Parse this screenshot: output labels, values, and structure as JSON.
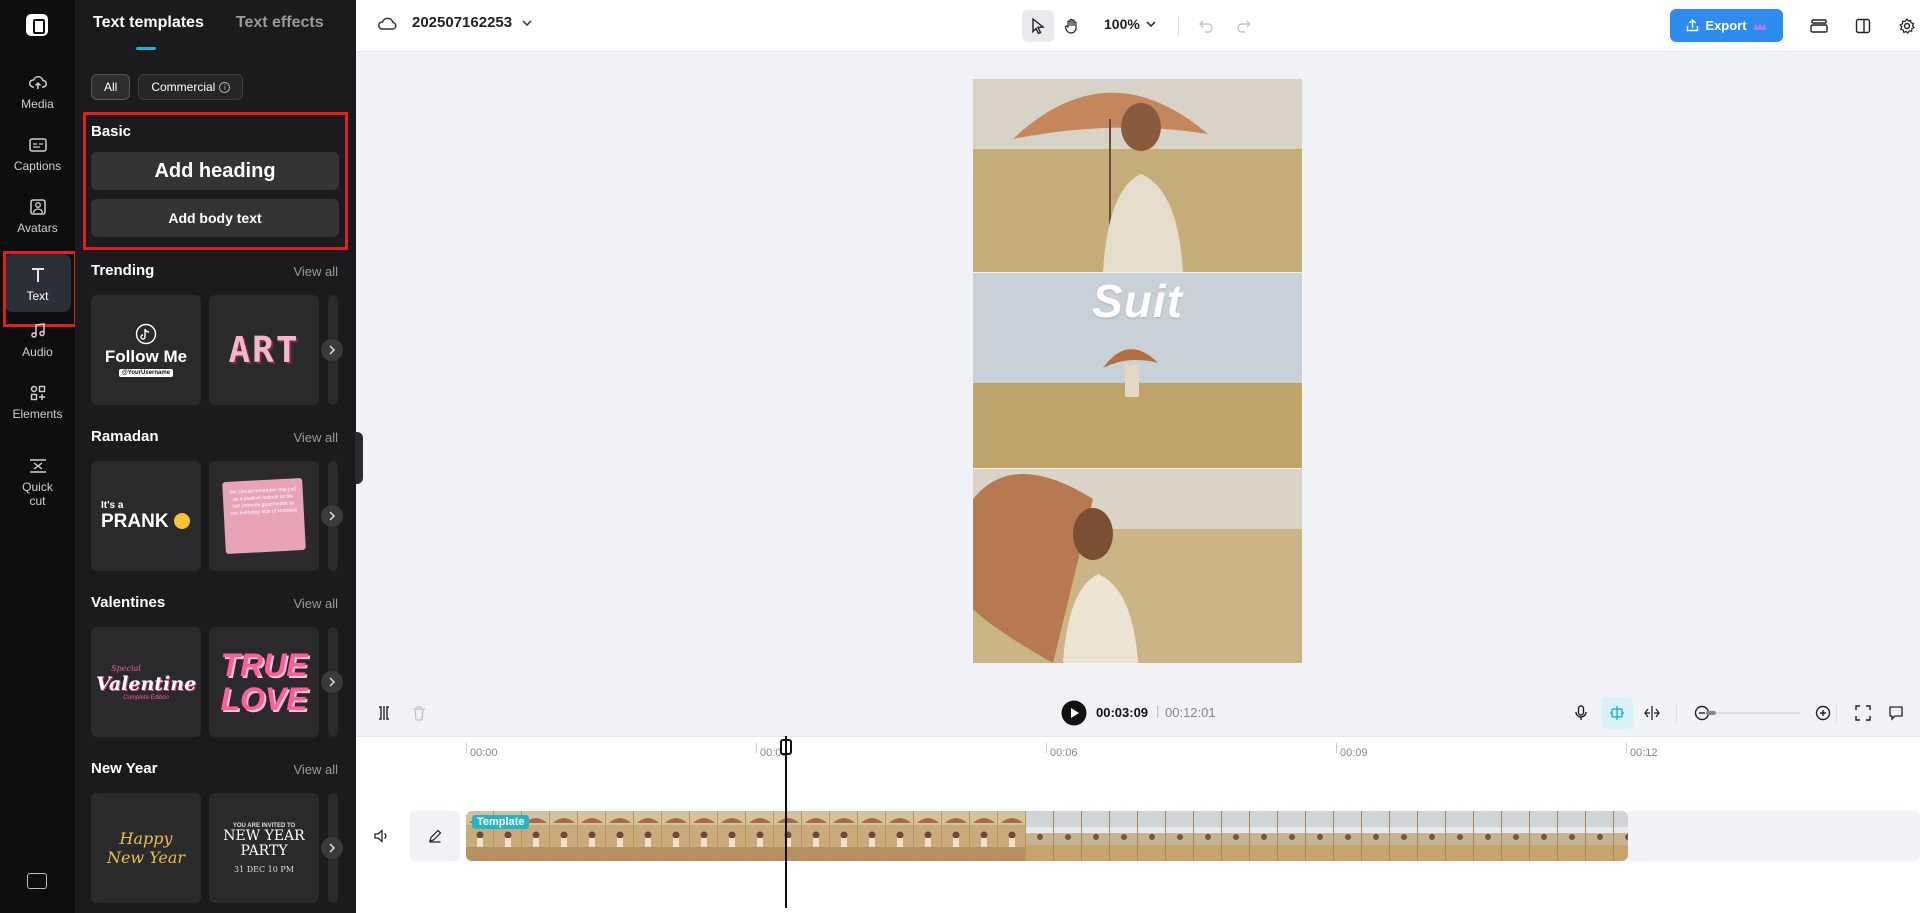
{
  "rail": {
    "items": [
      {
        "label": "Media",
        "icon": "cloud-upload-icon"
      },
      {
        "label": "Captions",
        "icon": "captions-icon"
      },
      {
        "label": "Avatars",
        "icon": "avatar-icon"
      },
      {
        "label": "Text",
        "icon": "text-icon",
        "active": true
      },
      {
        "label": "Audio",
        "icon": "music-note-icon"
      },
      {
        "label": "Elements",
        "icon": "elements-icon"
      },
      {
        "label": "Quick",
        "label2": "cut",
        "icon": "quick-cut-icon"
      }
    ]
  },
  "panel": {
    "tabs": [
      "Text templates",
      "Text effects"
    ],
    "filters": {
      "all": "All",
      "commercial": "Commercial"
    },
    "basic": {
      "title": "Basic",
      "heading_btn": "Add heading",
      "body_btn": "Add body text"
    },
    "view_all": "View all",
    "sections": [
      {
        "title": "Trending",
        "cards": [
          "Follow Me",
          "@YourUsername",
          "ART"
        ]
      },
      {
        "title": "Ramadan",
        "cards": [
          "It's a",
          "PRANK",
          "We should remember that just as a positive outlook on life can promote good health so can everyday acts of kindness"
        ]
      },
      {
        "title": "Valentines",
        "cards": [
          "Special",
          "Valentine",
          "Complete Edition",
          "TRUE",
          "LOVE"
        ]
      },
      {
        "title": "New Year",
        "cards": [
          "Happy",
          "New Year",
          "YOU ARE INVITED TO",
          "NEW YEAR PARTY",
          "31 DEC 10 PM"
        ]
      }
    ]
  },
  "topbar": {
    "project_name": "202507162253",
    "zoom": "100%",
    "export_label": "Export"
  },
  "canvas": {
    "overlay_text": "Suit"
  },
  "playback": {
    "current": "00:03:09",
    "total": "00:12:01"
  },
  "timeline": {
    "ticks": [
      "00:00",
      "00:03",
      "00:06",
      "00:09",
      "00:12"
    ],
    "track_tag": "Template"
  },
  "colors": {
    "accent": "#2e8cf0",
    "highlight": "#e02020",
    "tab_underline": "#1bb5d8"
  }
}
